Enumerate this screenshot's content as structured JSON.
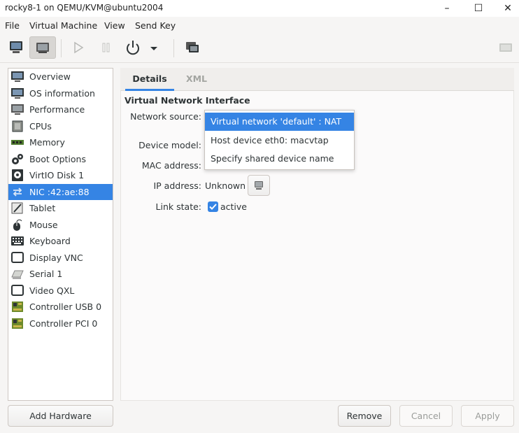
{
  "window": {
    "title": "rocky8-1 on QEMU/KVM@ubuntu2004",
    "minimize": "–",
    "maximize": "☐",
    "close": "✕"
  },
  "menu": [
    "File",
    "Virtual Machine",
    "View",
    "Send Key"
  ],
  "toolbar": {
    "icons": [
      "console-monitor-icon",
      "details-icon",
      "run-icon",
      "pause-icon",
      "power-icon",
      "power-menu-chevron-icon",
      "snapshots-icon",
      "fullscreen-icon"
    ]
  },
  "sidebar": {
    "items": [
      {
        "label": "Overview",
        "icon": "monitor-icon",
        "selected": false
      },
      {
        "label": "OS information",
        "icon": "monitor-icon",
        "selected": false
      },
      {
        "label": "Performance",
        "icon": "monitor-icon",
        "selected": false
      },
      {
        "label": "CPUs",
        "icon": "cpu-icon",
        "selected": false
      },
      {
        "label": "Memory",
        "icon": "memory-icon",
        "selected": false
      },
      {
        "label": "Boot Options",
        "icon": "gears-icon",
        "selected": false
      },
      {
        "label": "VirtIO Disk 1",
        "icon": "disk-icon",
        "selected": false
      },
      {
        "label": "NIC :42:ae:88",
        "icon": "network-icon",
        "selected": true
      },
      {
        "label": "Tablet",
        "icon": "tablet-icon",
        "selected": false
      },
      {
        "label": "Mouse",
        "icon": "mouse-icon",
        "selected": false
      },
      {
        "label": "Keyboard",
        "icon": "keyboard-icon",
        "selected": false
      },
      {
        "label": "Display VNC",
        "icon": "display-icon",
        "selected": false
      },
      {
        "label": "Serial 1",
        "icon": "serial-icon",
        "selected": false
      },
      {
        "label": "Video QXL",
        "icon": "display-icon",
        "selected": false
      },
      {
        "label": "Controller USB 0",
        "icon": "controller-icon",
        "selected": false
      },
      {
        "label": "Controller PCI 0",
        "icon": "controller-icon",
        "selected": false
      }
    ],
    "add_hardware": "Add Hardware"
  },
  "tabs": {
    "details": "Details",
    "xml": "XML"
  },
  "nic": {
    "section_title": "Virtual Network Interface",
    "network_source_label": "Network source:",
    "device_model_label": "Device model:",
    "mac_address_label": "MAC address:",
    "ip_address_label": "IP address:",
    "ip_address_value": "Unknown",
    "link_state_label": "Link state:",
    "link_state_value": "active",
    "link_state_checked": true
  },
  "dropdown": {
    "options": [
      {
        "label": "Virtual network 'default' : NAT",
        "selected": true
      },
      {
        "label": "Host device eth0: macvtap",
        "selected": false
      },
      {
        "label": "Specify shared device name",
        "selected": false
      }
    ]
  },
  "buttons": {
    "remove": "Remove",
    "cancel": "Cancel",
    "apply": "Apply"
  },
  "colors": {
    "accent": "#3584e4",
    "background": "#f6f5f4"
  }
}
